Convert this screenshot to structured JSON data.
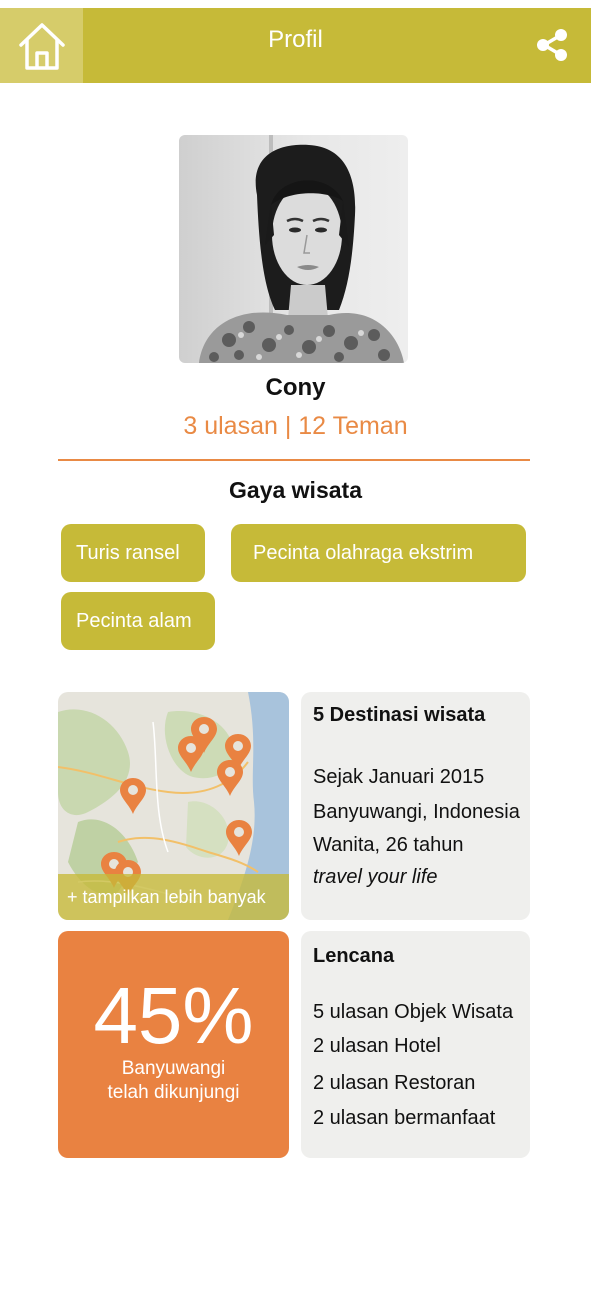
{
  "header": {
    "title": "Profil",
    "home_icon": "home-icon",
    "share_icon": "share-icon",
    "bar_color": "#c6ba38"
  },
  "profile": {
    "name": "Cony",
    "stats": "3 ulasan | 12 Teman",
    "accent_color": "#e98a45"
  },
  "travel_style": {
    "title": "Gaya wisata",
    "tags": [
      "Turis ransel",
      "Pecinta olahraga ekstrim",
      "Pecinta alam"
    ]
  },
  "map": {
    "more_label": "+ tampilkan lebih banyak",
    "pin_icon": "map-pin-icon"
  },
  "info": {
    "destinations": "5 Destinasi wisata",
    "since": "Sejak Januari 2015",
    "location": "Banyuwangi, Indonesia",
    "gender_age": "Wanita, 26 tahun",
    "motto": "travel your life"
  },
  "progress": {
    "percent": "45%",
    "label_line1": "Banyuwangi",
    "label_line2": "telah dikunjungi"
  },
  "badges": {
    "title": "Lencana",
    "items": [
      "5 ulasan Objek Wisata",
      "2 ulasan Hotel",
      "2 ulasan Restoran",
      "2 ulasan bermanfaat"
    ]
  }
}
